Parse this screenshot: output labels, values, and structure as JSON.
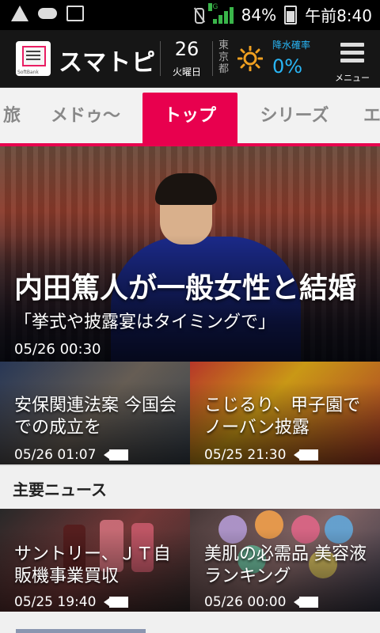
{
  "status_bar": {
    "battery": "84%",
    "time": "午前8:40",
    "network": "3G",
    "icons": [
      "warning-icon",
      "cloud-upload-icon",
      "image-icon",
      "mute-icon",
      "signal-icon",
      "battery-icon"
    ]
  },
  "header": {
    "app_name": "スマトピ",
    "logo_caption": "SoftBank",
    "date_number": "26",
    "day_label": "火曜日",
    "city": "東京都",
    "weather_icon": "sun-icon",
    "rain_label": "降水確率",
    "rain_value": "0%",
    "menu_label": "メニュー"
  },
  "tabs": [
    {
      "label": "旅",
      "active": false
    },
    {
      "label": "メドゥ～",
      "active": false
    },
    {
      "label": "トップ",
      "active": true
    },
    {
      "label": "シリーズ",
      "active": false
    },
    {
      "label": "エ",
      "active": false
    }
  ],
  "hero": {
    "title": "内田篤人が一般女性と結婚",
    "subtitle": "「挙式や披露宴はタイミングで」",
    "time": "05/26 00:30"
  },
  "cards_top": [
    {
      "title": "安保関連法案 今国会での成立を",
      "time": "05/26 01:07",
      "has_video": true
    },
    {
      "title": "こじるり、甲子園でノーバン披露",
      "time": "05/25 21:30",
      "has_video": true
    }
  ],
  "section": {
    "title": "主要ニュース"
  },
  "cards_bottom": [
    {
      "title": "サントリー、ＪＴ自販機事業買収",
      "time": "05/25 19:40",
      "has_video": true
    },
    {
      "title": "美肌の必需品 美容液ランキング",
      "time": "05/26 00:00",
      "has_video": true
    }
  ],
  "colors": {
    "accent": "#e8004e",
    "rain_blue": "#29b6f6",
    "signal_green": "#3ab54a"
  }
}
